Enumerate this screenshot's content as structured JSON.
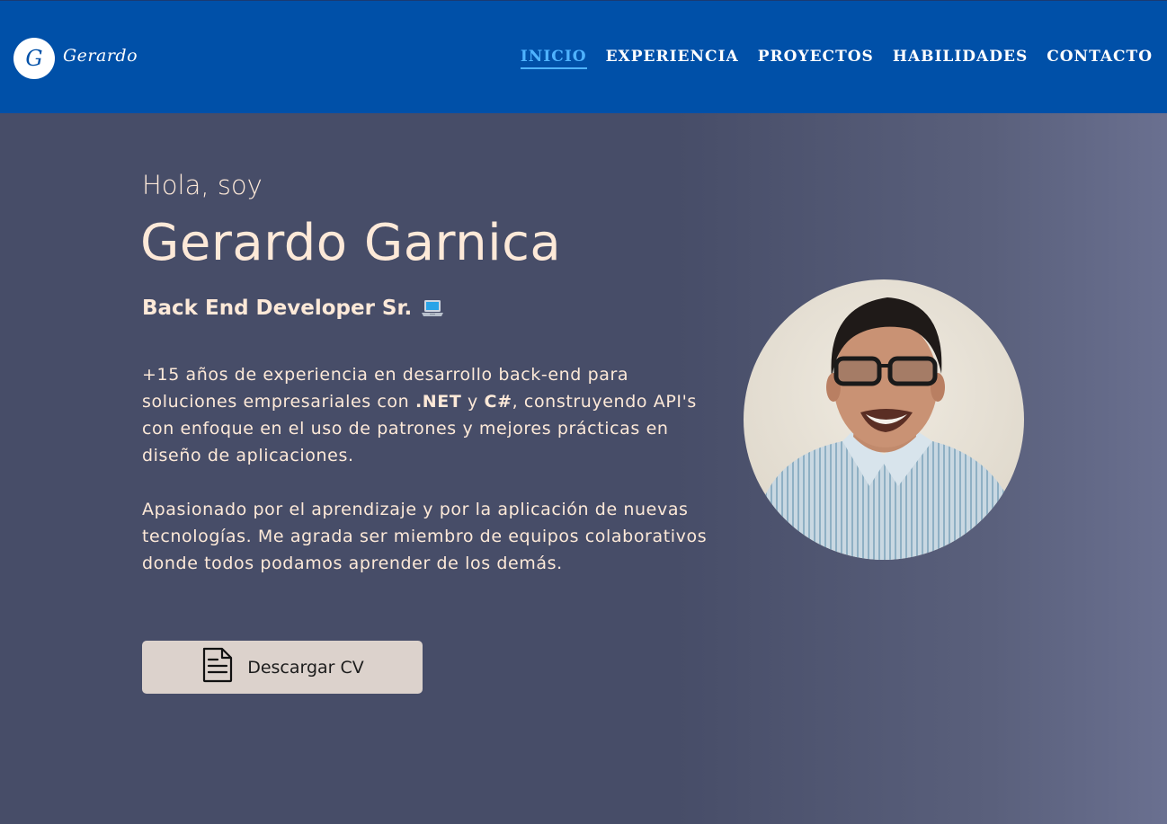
{
  "nav": {
    "logo_letter": "G",
    "logo_text": "Gerardo",
    "links": [
      "INICIO",
      "EXPERIENCIA",
      "PROYECTOS",
      "HABILIDADES",
      "CONTACTO"
    ],
    "active": "INICIO",
    "background": "#0050a8",
    "active_color": "#4fb3ff"
  },
  "hero": {
    "greeting": "Hola, soy",
    "name": "Gerardo Garnica",
    "role": "Back End Developer Sr.",
    "role_icon": "laptop-icon",
    "para1": {
      "part1": "+15 años de experiencia en desarrollo back-end para soluciones empresariales con ",
      "bold1": ".NET",
      "part2": " y ",
      "bold2": "C#",
      "part3": ", construyendo API's con enfoque en el uso de patrones y mejores prácticas en diseño de aplicaciones."
    },
    "para2": "Apasionado por el aprendizaje y por la aplicación de nuevas tecnologías. Me agrada ser miembro de equipos colaborativos donde todos podamos aprender de los demás.",
    "cv_button_label": "Descargar CV",
    "cv_button_icon": "document-icon",
    "photo_icon": "profile-photo",
    "text_color": "#fde9d8",
    "background": "#474d68"
  }
}
